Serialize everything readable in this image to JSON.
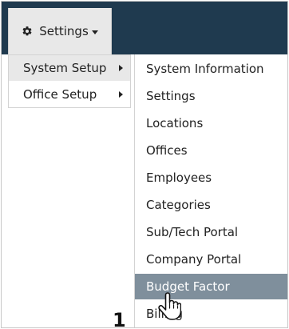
{
  "toolbar": {
    "settings_label": "Settings",
    "settings_icon": "gear-icon",
    "caret_icon": "caret-down-icon"
  },
  "menu": {
    "level1": [
      {
        "label": "System Setup",
        "active": true,
        "icon": "chevron-right-icon"
      },
      {
        "label": "Office Setup",
        "active": false,
        "icon": "chevron-right-icon"
      }
    ],
    "level2": [
      {
        "label": "System Information"
      },
      {
        "label": "Settings"
      },
      {
        "label": "Locations"
      },
      {
        "label": "Offices"
      },
      {
        "label": "Employees"
      },
      {
        "label": "Categories"
      },
      {
        "label": "Sub/Tech Portal"
      },
      {
        "label": "Company Portal"
      },
      {
        "label": "Budget Factor",
        "hover": true
      },
      {
        "label": "Billing"
      }
    ]
  },
  "background": {
    "partial_glyph": "1"
  },
  "cursor": {
    "icon": "hand-pointer-icon"
  },
  "colors": {
    "topbar": "#1f3a4f",
    "button_bg": "#e8e8e8",
    "hover_bg": "#7f8f9c",
    "menu_border": "#d3d3d3"
  }
}
